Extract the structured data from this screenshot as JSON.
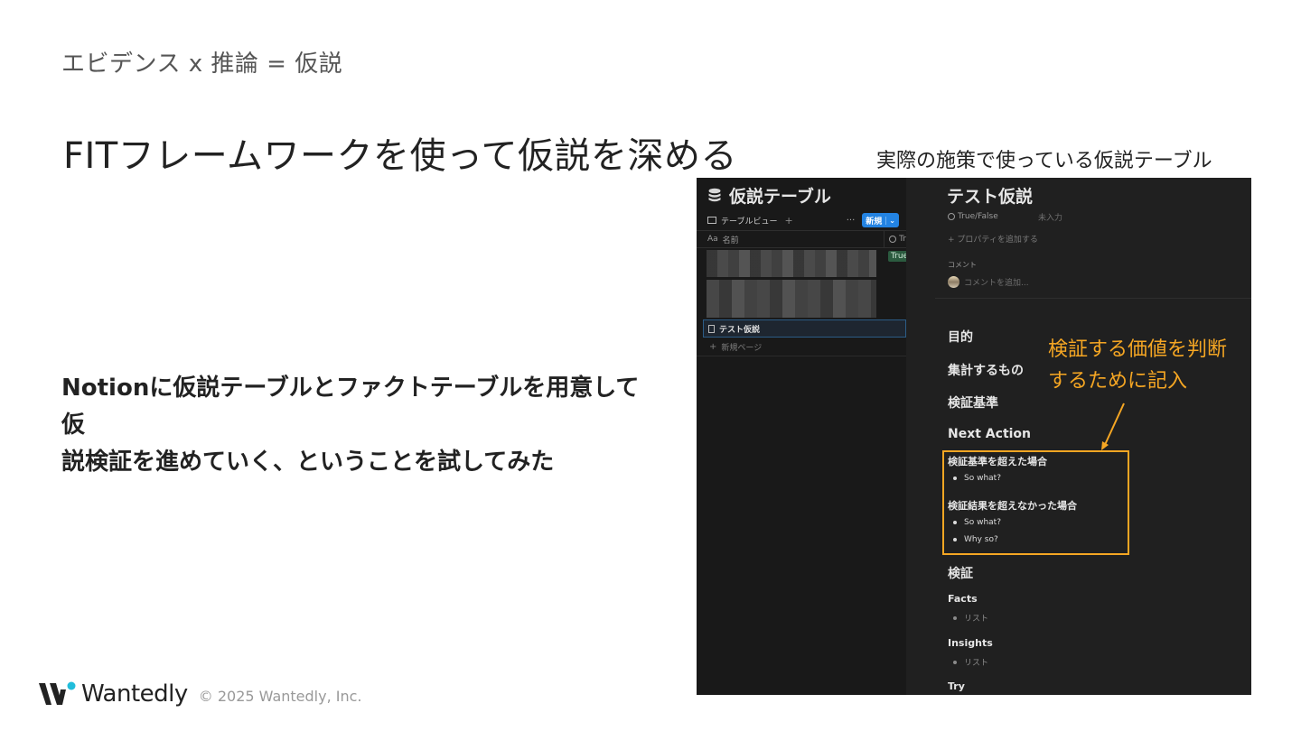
{
  "slide": {
    "breadcrumb": "エビデンス x 推論 = 仮説",
    "title": "FITフレームワークを使って仮説を深める",
    "body_line1": "Notionに仮説テーブルとファクトテーブルを用意して仮",
    "body_line2": "説検証を進めていく、ということを試してみた",
    "caption": "実際の施策で使っている仮説テーブル",
    "annotation_line1": "検証する価値を判断",
    "annotation_line2": "するために記入",
    "accent_color": "#f5a623"
  },
  "footer": {
    "brand": "Wantedly",
    "copyright": "© 2025 Wantedly, Inc."
  },
  "notion": {
    "database_icon": "database-icon",
    "database_title": "仮説テーブル",
    "view_label": "テーブルビュー",
    "view_add": "+",
    "more": "···",
    "new_button": "新規",
    "column_name_prefix": "Aa",
    "column_name": "名前",
    "column_tf": "Tr",
    "true_tag": "True",
    "selected_row": "テスト仮説",
    "new_page": "新規ページ",
    "page_title": "テスト仮説",
    "prop_name": "True/False",
    "prop_value": "未入力",
    "add_property": "+ プロパティを追加する",
    "comment_label": "コメント",
    "comment_placeholder": "コメントを追加...",
    "sections": {
      "purpose": "目的",
      "aggregate": "集計するもの",
      "criteria": "検証基準",
      "next_action": "Next Action",
      "exceeded": "検証基準を超えた場合",
      "so_what_1": "So what?",
      "not_exceeded": "検証結果を超えなかった場合",
      "so_what_2": "So what?",
      "why_so": "Why so?",
      "verify": "検証",
      "facts": "Facts",
      "facts_list": "リスト",
      "insights": "Insights",
      "insights_list": "リスト",
      "try": "Try"
    }
  }
}
